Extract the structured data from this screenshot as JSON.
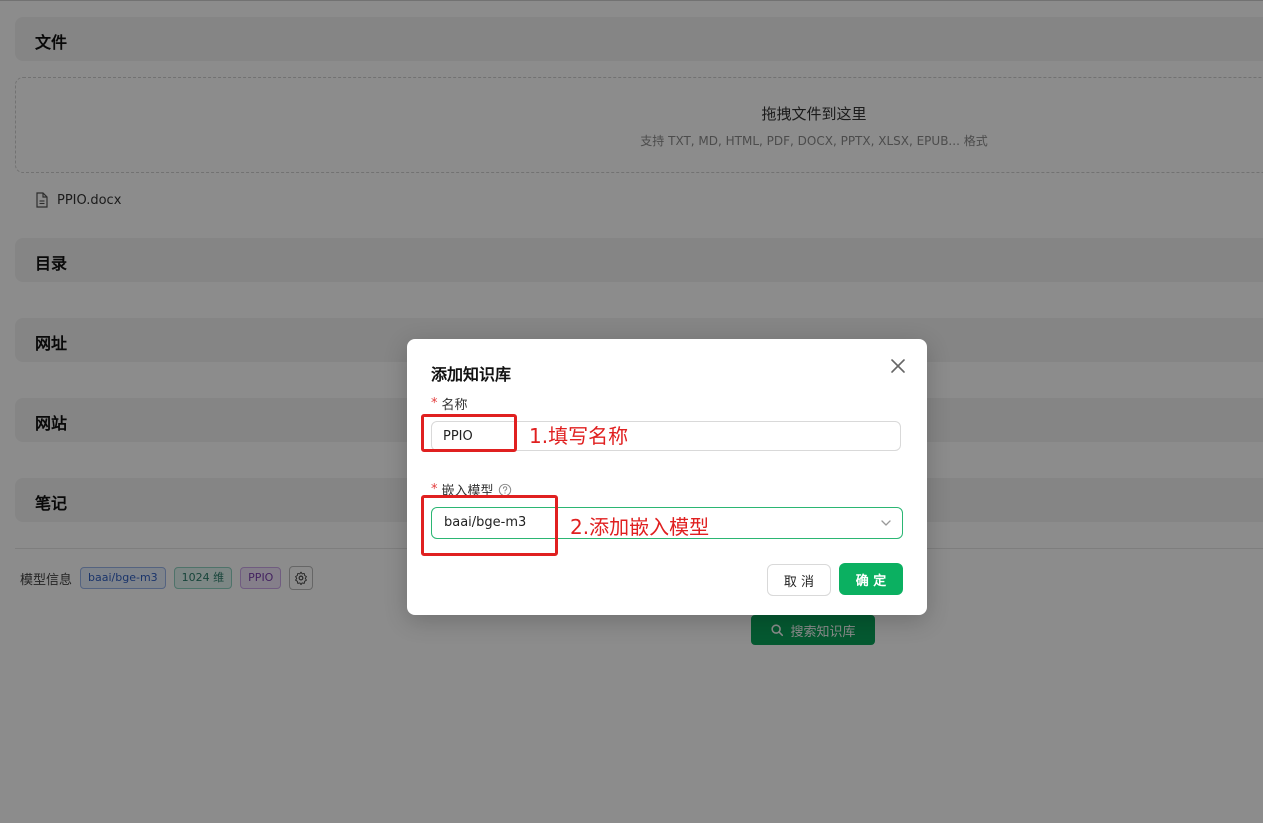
{
  "sections": {
    "files": "文件",
    "directory": "目录",
    "url": "网址",
    "website": "网站",
    "notes": "笔记"
  },
  "dropzone": {
    "title": "拖拽文件到这里",
    "hint": "支持 TXT, MD, HTML, PDF, DOCX, PPTX, XLSX, EPUB... 格式"
  },
  "files": [
    {
      "name": "PPIO.docx",
      "icon": "file-icon"
    }
  ],
  "model_info": {
    "label": "模型信息",
    "model": "baai/bge-m3",
    "dimensions": "1024 维",
    "provider": "PPIO",
    "settings_icon": "gear-icon"
  },
  "search_button": {
    "label": "搜索知识库",
    "icon": "search-icon"
  },
  "modal": {
    "title": "添加知识库",
    "name_label": "名称",
    "name_value": "PPIO",
    "embedding_label": "嵌入模型",
    "embedding_value": "baai/bge-m3",
    "cancel": "取 消",
    "ok": "确 定",
    "required_mark": "*"
  },
  "annotations": {
    "step1": "1.填写名称",
    "step2": "2.添加嵌入模型"
  },
  "colors": {
    "accent": "#0bb061",
    "annotation": "#e02020",
    "overlay": "rgba(0,0,0,0.45)"
  }
}
